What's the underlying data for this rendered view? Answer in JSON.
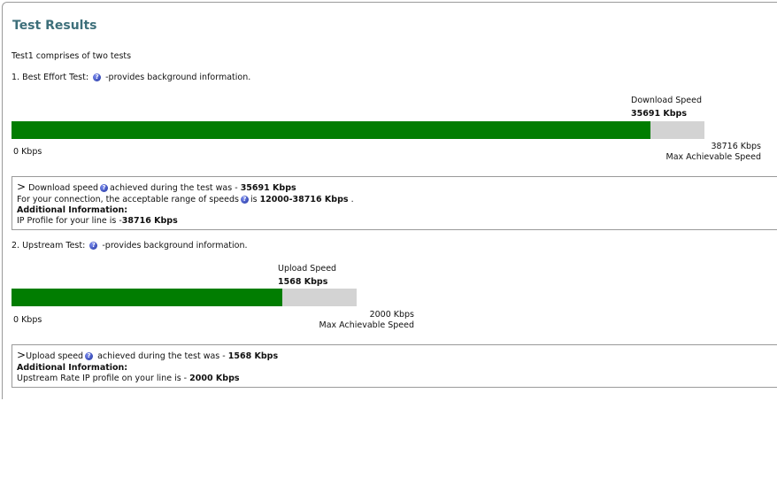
{
  "header": {
    "title": "Test Results"
  },
  "intro": "Test1 comprises of two tests",
  "best_effort": {
    "heading": "1. Best Effort Test:",
    "help_icon": "help-icon",
    "help_text": "-provides background information.",
    "speed_label": "Download Speed",
    "speed_value": "35691 Kbps",
    "fill_fraction": 0.9218,
    "min_label": "0 Kbps",
    "max_value": "38716 Kbps",
    "max_label": "Max Achievable Speed",
    "result": {
      "arrow": ">",
      "line1_a": "Download speed",
      "line1_b": "achieved during the test was -",
      "line1_value": "35691 Kbps",
      "line2_a": "For your connection, the acceptable range of speeds",
      "line2_b": "is",
      "line2_value": "12000-38716 Kbps",
      "line2_end": ".",
      "additional": "Additional Information:",
      "line4_a": "IP Profile for your line is -",
      "line4_value": "38716 Kbps"
    }
  },
  "upstream": {
    "heading": "2. Upstream Test:",
    "help_text": "-provides background information.",
    "speed_label": "Upload Speed",
    "speed_value": "1568 Kbps",
    "fill_fraction": 0.784,
    "min_label": "0 Kbps",
    "max_value": "2000 Kbps",
    "max_label": "Max Achievable Speed",
    "result": {
      "arrow": ">",
      "line1_a": "Upload speed",
      "line1_b": "achieved during the test was -",
      "line1_value": "1568 Kbps",
      "additional": "Additional Information:",
      "line3_a": "Upstream Rate IP profile on your line is -",
      "line3_value": "2000 Kbps"
    }
  },
  "colors": {
    "bar_fill": "#017d01",
    "bar_track": "#d3d3d3",
    "title": "#3d6f7a"
  }
}
